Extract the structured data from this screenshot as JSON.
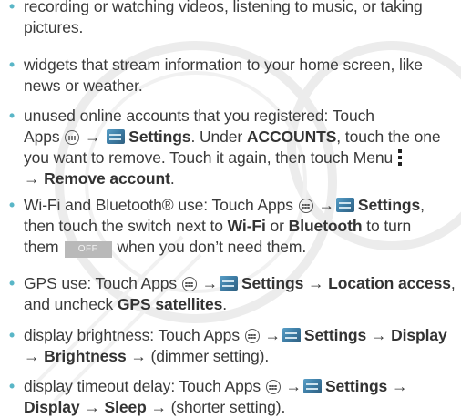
{
  "items": [
    {
      "lines": [
        "recording or watching videos, listening to music, or taking",
        "pictures."
      ]
    },
    {
      "lines": [
        "widgets that stream information to your home screen, like",
        "news or weather."
      ]
    },
    {
      "l1": "unused online accounts that you registered: Touch",
      "l2a": "Apps",
      "l2b": "Settings",
      "l2c": ". Under ",
      "l2d": "ACCOUNTS",
      "l2e": ", touch the one",
      "l3": "you want to remove. Touch it again, then touch Menu",
      "l4a": "→ ",
      "l4b": "Remove account",
      "l4c": "."
    },
    {
      "l1a": "Wi-Fi and Bluetooth® use: Touch Apps",
      "l1b": "→",
      "l1c": "Settings",
      "l1d": ",",
      "l2a": "then touch the switch next to ",
      "l2b": "Wi-Fi",
      "l2c": " or ",
      "l2d": "Bluetooth",
      "l2e": " to turn",
      "l3a": "them",
      "off": "OFF",
      "l3b": "when you don’t need them."
    },
    {
      "l1a": "GPS use: Touch Apps",
      "l1b": "→",
      "l1c": "Settings",
      "l1d": " → ",
      "l1e": "Location access",
      "l1f": ",",
      "l2a": "and uncheck ",
      "l2b": "GPS satellites",
      "l2c": "."
    },
    {
      "l1a": "display brightness: Touch Apps",
      "l1b": "→",
      "l1c": "Settings",
      "l1d": " → ",
      "l1e": "Display",
      "l2a": "→ ",
      "l2b": "Brightness",
      "l2c": " → (dimmer setting)."
    },
    {
      "l1a": "display timeout delay: Touch Apps",
      "l1b": "→",
      "l1c": "Settings",
      "l1d": " →",
      "l2a": "Display",
      "l2b": " → ",
      "l2c": "Sleep",
      "l2d": " → (shorter setting)."
    }
  ],
  "bullet_glyph": "•",
  "colors": {
    "bullet": "#59b6c7",
    "text": "#3a3a3a",
    "off_button": "#b9b9b9"
  },
  "icons": {
    "apps": "apps-icon",
    "settings": "settings-icon",
    "menu": "menu-icon"
  }
}
